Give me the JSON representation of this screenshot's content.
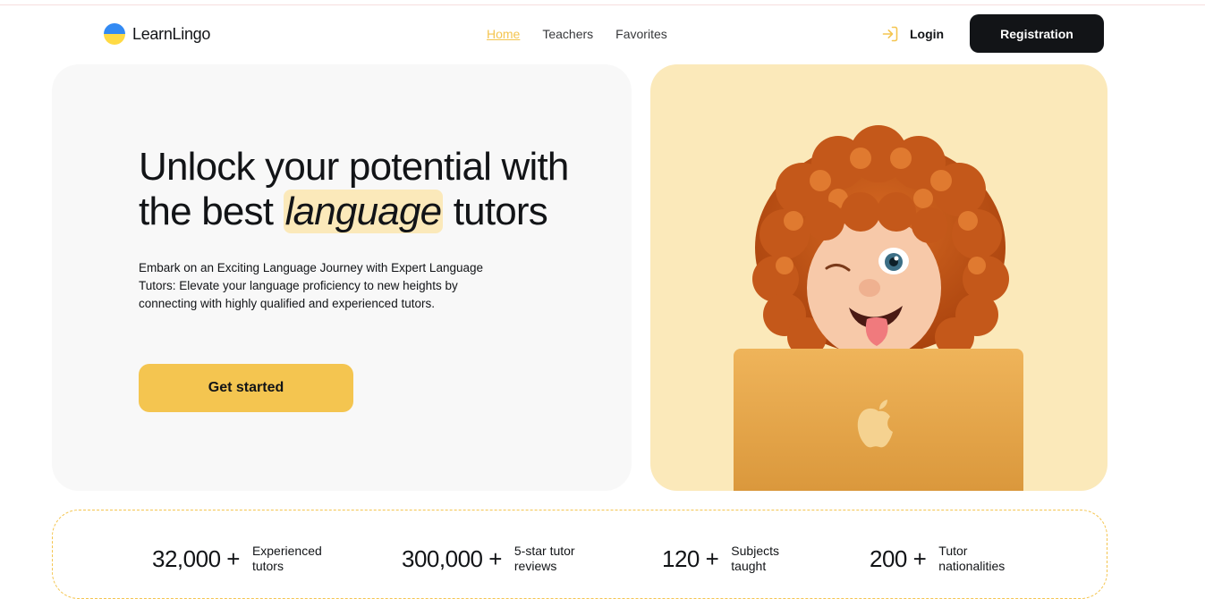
{
  "brand": {
    "name": "LearnLingo",
    "flag_colors": [
      "#338af3",
      "#ffda44"
    ]
  },
  "nav": {
    "items": [
      {
        "label": "Home",
        "active": true
      },
      {
        "label": "Teachers",
        "active": false
      },
      {
        "label": "Favorites",
        "active": false
      }
    ]
  },
  "auth": {
    "login_label": "Login",
    "login_icon": "login-arrow-icon",
    "register_label": "Registration"
  },
  "hero": {
    "title_part1": "Unlock your potential with the best",
    "title_highlight": "language",
    "title_part2": "tutors",
    "description": "Embark on an Exciting Language Journey with Expert Language Tutors: Elevate your language proficiency to new heights by connecting with highly qualified and experienced tutors.",
    "cta_label": "Get started",
    "illustration": "memoji-with-laptop"
  },
  "stats": [
    {
      "value": "32,000 +",
      "label": "Experienced tutors"
    },
    {
      "value": "300,000 +",
      "label": "5-star tutor reviews"
    },
    {
      "value": "120 +",
      "label": "Subjects taught"
    },
    {
      "value": "200 +",
      "label": "Tutor nationalities"
    }
  ],
  "colors": {
    "accent": "#f4c550",
    "accent_light": "#fbe9ba",
    "dark": "#121417",
    "panel": "#f8f8f8"
  }
}
